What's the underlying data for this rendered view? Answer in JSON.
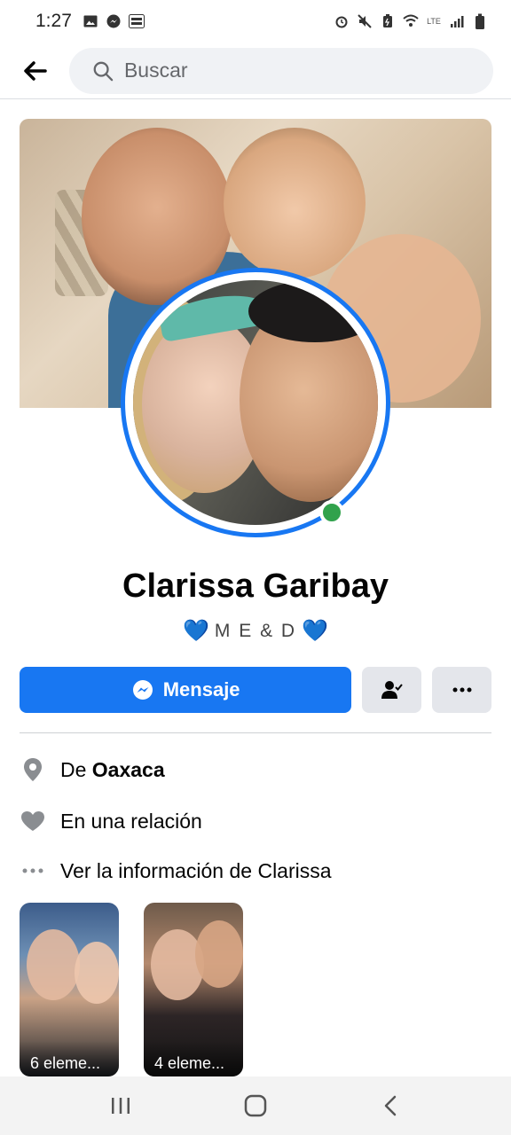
{
  "status_bar": {
    "time": "1:27",
    "left_icons": [
      "image-icon",
      "messenger-icon",
      "app-icon"
    ],
    "right_icons": [
      "alarm-icon",
      "mute-icon",
      "battery-saver-icon",
      "wifi-icon",
      "lte-icon",
      "signal-icon",
      "battery-icon"
    ]
  },
  "header": {
    "search_placeholder": "Buscar"
  },
  "profile": {
    "name": "Clarissa Garibay",
    "bio_text": "M E & D",
    "bio_emoji": "💙",
    "online": true,
    "accent_color": "#1877f2",
    "online_color": "#31a24c"
  },
  "actions": {
    "message_label": "Mensaje",
    "friend_button_icon": "friends-check-icon",
    "more_button_icon": "more-dots-icon"
  },
  "info": {
    "from_prefix": "De",
    "from_city": "Oaxaca",
    "relationship": "En una relación",
    "see_more": "Ver la información de Clarissa"
  },
  "collections": [
    {
      "label": "6 eleme..."
    },
    {
      "label": "4 eleme..."
    }
  ],
  "nav": {
    "icons": [
      "recent-apps-icon",
      "home-icon",
      "back-icon"
    ]
  }
}
